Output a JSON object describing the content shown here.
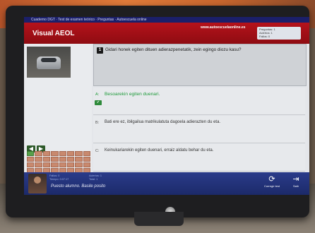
{
  "window": {
    "titlebar": "Cuaderno DGT · Test de examen teórico · Preguntas · Autoescuela online"
  },
  "header": {
    "brand": "Visual AEOL",
    "site": "www.autoescuelaonline.es",
    "stats": [
      "Preguntas: 1",
      "Aciertos: 1",
      "Fallos: 0"
    ]
  },
  "question": {
    "number": "1",
    "text": "Gidari honek egiten dituen adierazpenetatik, zein egingo diozu kasu?"
  },
  "answers": [
    {
      "letter": "A:",
      "text": "Besoarekin egiten duenari."
    },
    {
      "letter": "B:",
      "text": "Bati ere ez, ibilgailua matrikulatuta dagoela adierazten du eta."
    },
    {
      "letter": "C:",
      "text": "Keinukariarekin egiten duenari, erraiz aldatu behar du eta."
    }
  ],
  "footer": {
    "stats": [
      "Fallos: 0",
      "Aciertos: 1",
      "Tiempo: 0:07:17",
      "Total: 1"
    ],
    "message": "Puesto alumno. Basile posito",
    "buttons": [
      {
        "icon": "refresh-icon",
        "label": "Corregir test"
      },
      {
        "icon": "exit-icon",
        "label": "Salir"
      }
    ]
  }
}
